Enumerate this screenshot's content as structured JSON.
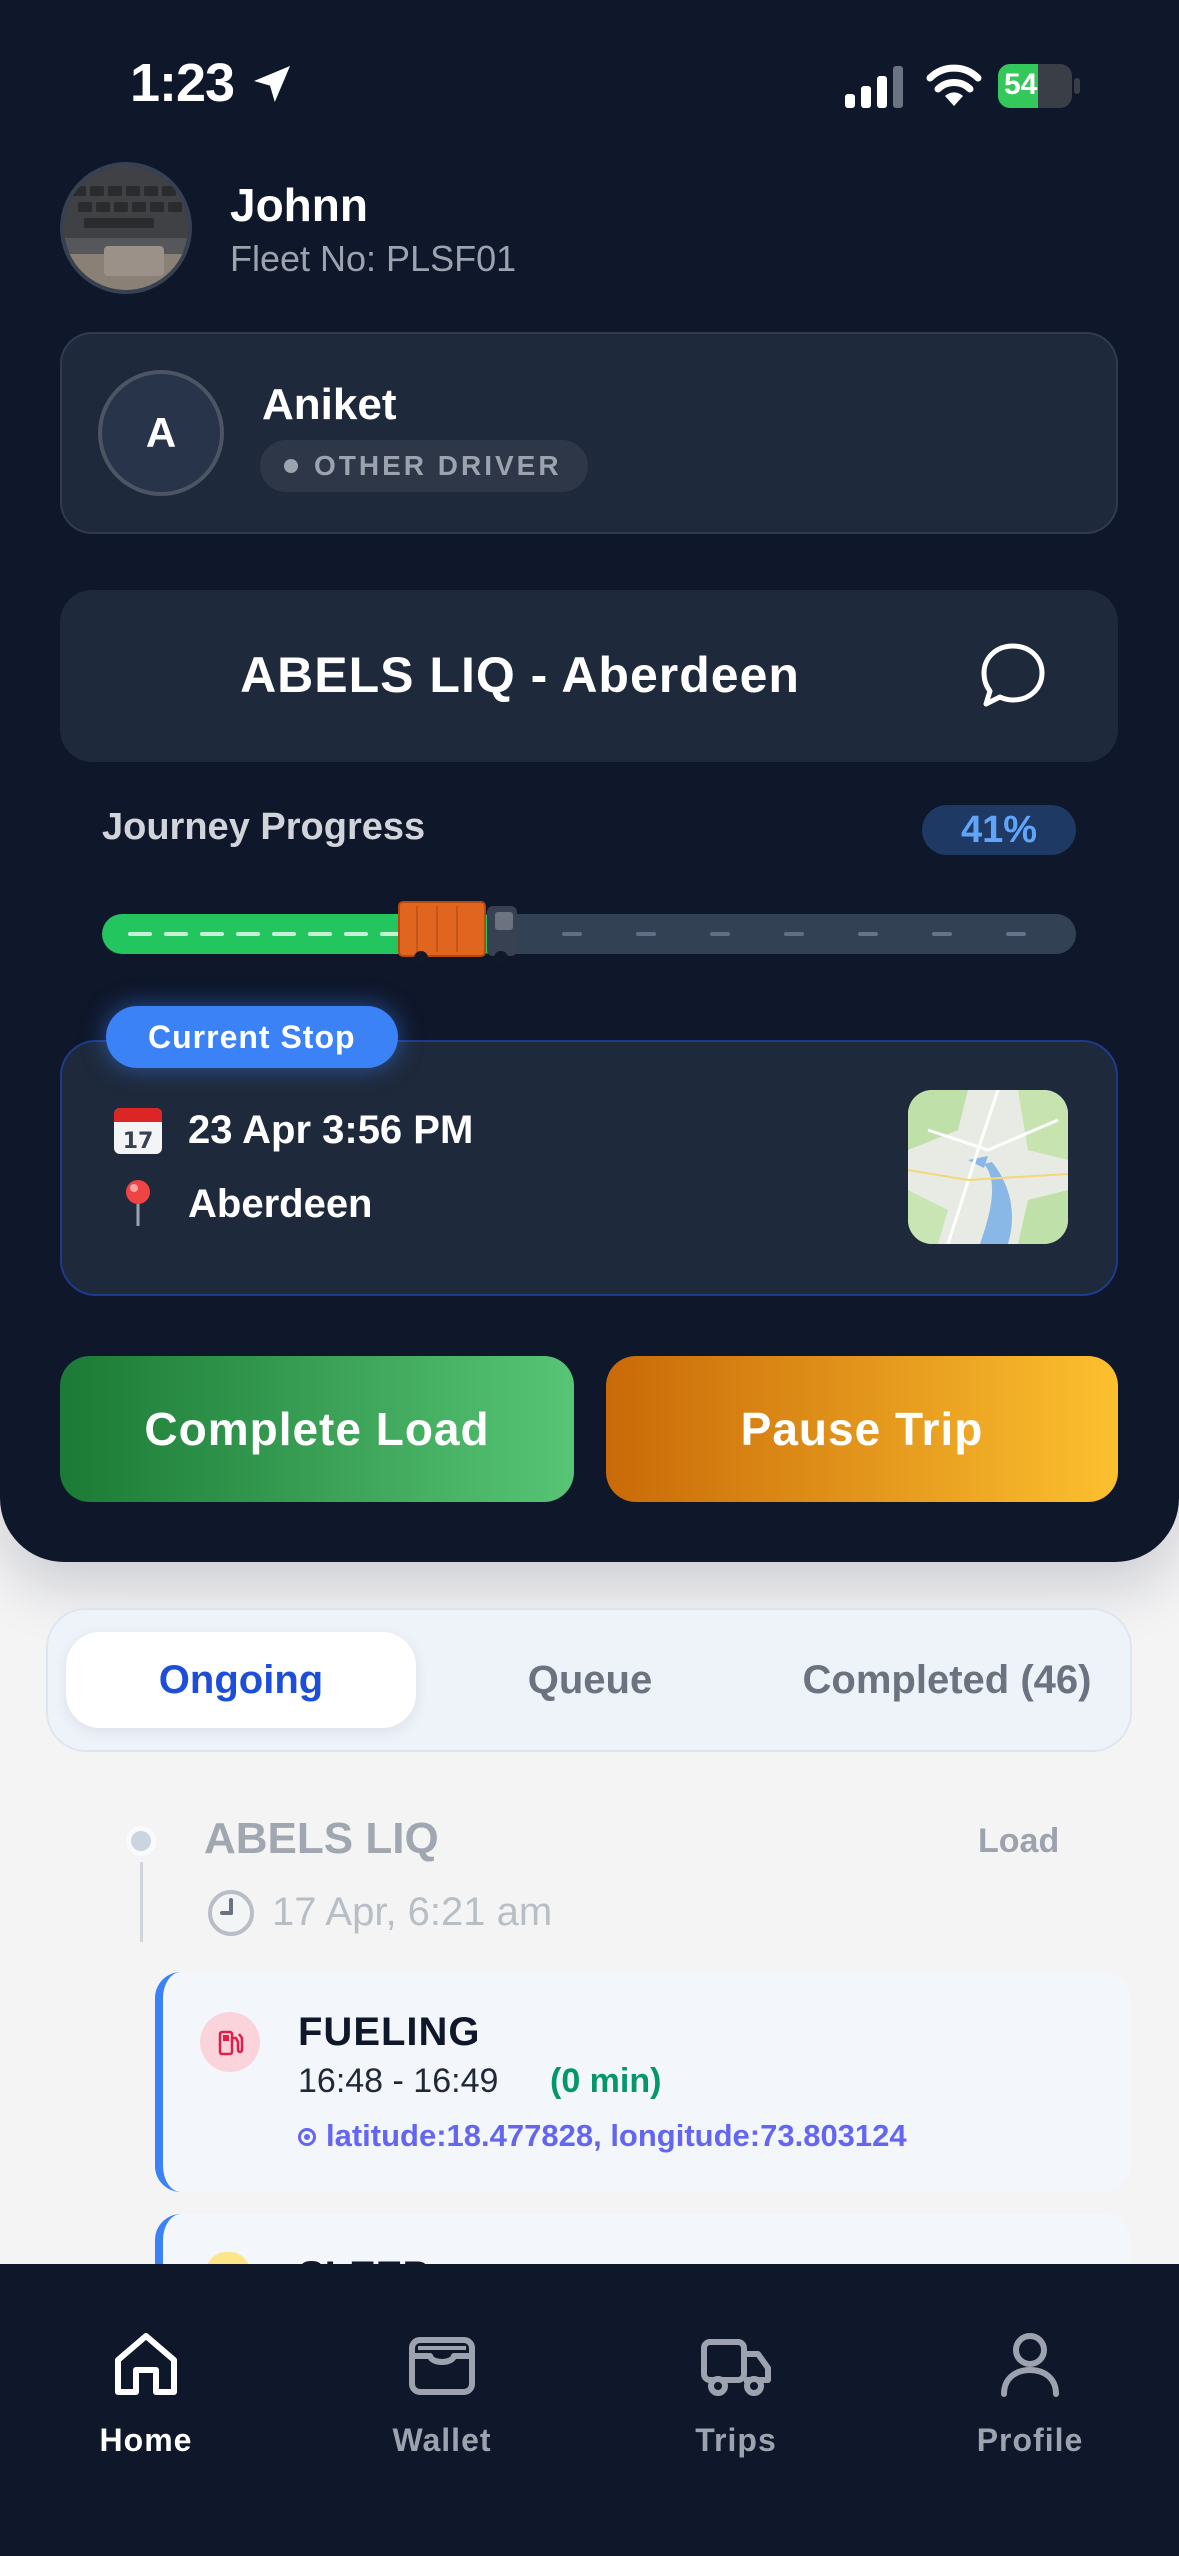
{
  "status_bar": {
    "time": "1:23",
    "battery": "54",
    "battery_level": 0.54
  },
  "user": {
    "name": "Johnn",
    "fleet": "Fleet No: PLSF01"
  },
  "other_driver": {
    "initial": "A",
    "name": "Aniket",
    "badge": "OTHER DRIVER"
  },
  "route": {
    "title": "ABELS LIQ - Aberdeen"
  },
  "journey": {
    "label": "Journey Progress",
    "percent_label": "41%",
    "progress": 0.41
  },
  "current_stop": {
    "badge": "Current Stop",
    "date": "23 Apr 3:56 PM",
    "place": "Aberdeen"
  },
  "actions": {
    "complete": "Complete Load",
    "pause": "Pause Trip"
  },
  "tabs": {
    "ongoing": "Ongoing",
    "queue": "Queue",
    "completed": "Completed (46)",
    "active": "ongoing"
  },
  "timeline": {
    "title": "ABELS LIQ",
    "type": "Load",
    "date": "17 Apr, 6:21 am",
    "events": [
      {
        "title": "FUELING",
        "time": "16:48 - 16:49",
        "duration": "(0 min)",
        "coords": "latitude:18.477828, longitude:73.803124"
      },
      {
        "title": "SLEEP"
      }
    ]
  },
  "nav": {
    "items": [
      {
        "label": "Home",
        "active": true
      },
      {
        "label": "Wallet",
        "active": false
      },
      {
        "label": "Trips",
        "active": false
      },
      {
        "label": "Profile",
        "active": false
      }
    ]
  },
  "colors": {
    "panel": "#0f172a",
    "card": "#1e293b",
    "accent_blue": "#3b82f6",
    "progress_green": "#22c55e",
    "complete_start": "#1b7a35",
    "complete_end": "#57c575",
    "pause_start": "#c96a08",
    "pause_end": "#fcc02f",
    "nav_active": "#ffffff",
    "nav_inactive": "#9ca3af"
  },
  "icons": {
    "location": "location-arrow-icon",
    "signal": "cellular-signal-icon",
    "wifi": "wifi-icon",
    "chat": "chat-bubble-icon",
    "calendar": "calendar-icon",
    "pin": "map-pin-icon",
    "clock": "clock-icon",
    "fuel": "fuel-pump-icon",
    "home": "home-icon",
    "wallet": "wallet-icon",
    "trips": "truck-icon",
    "profile": "person-icon"
  }
}
